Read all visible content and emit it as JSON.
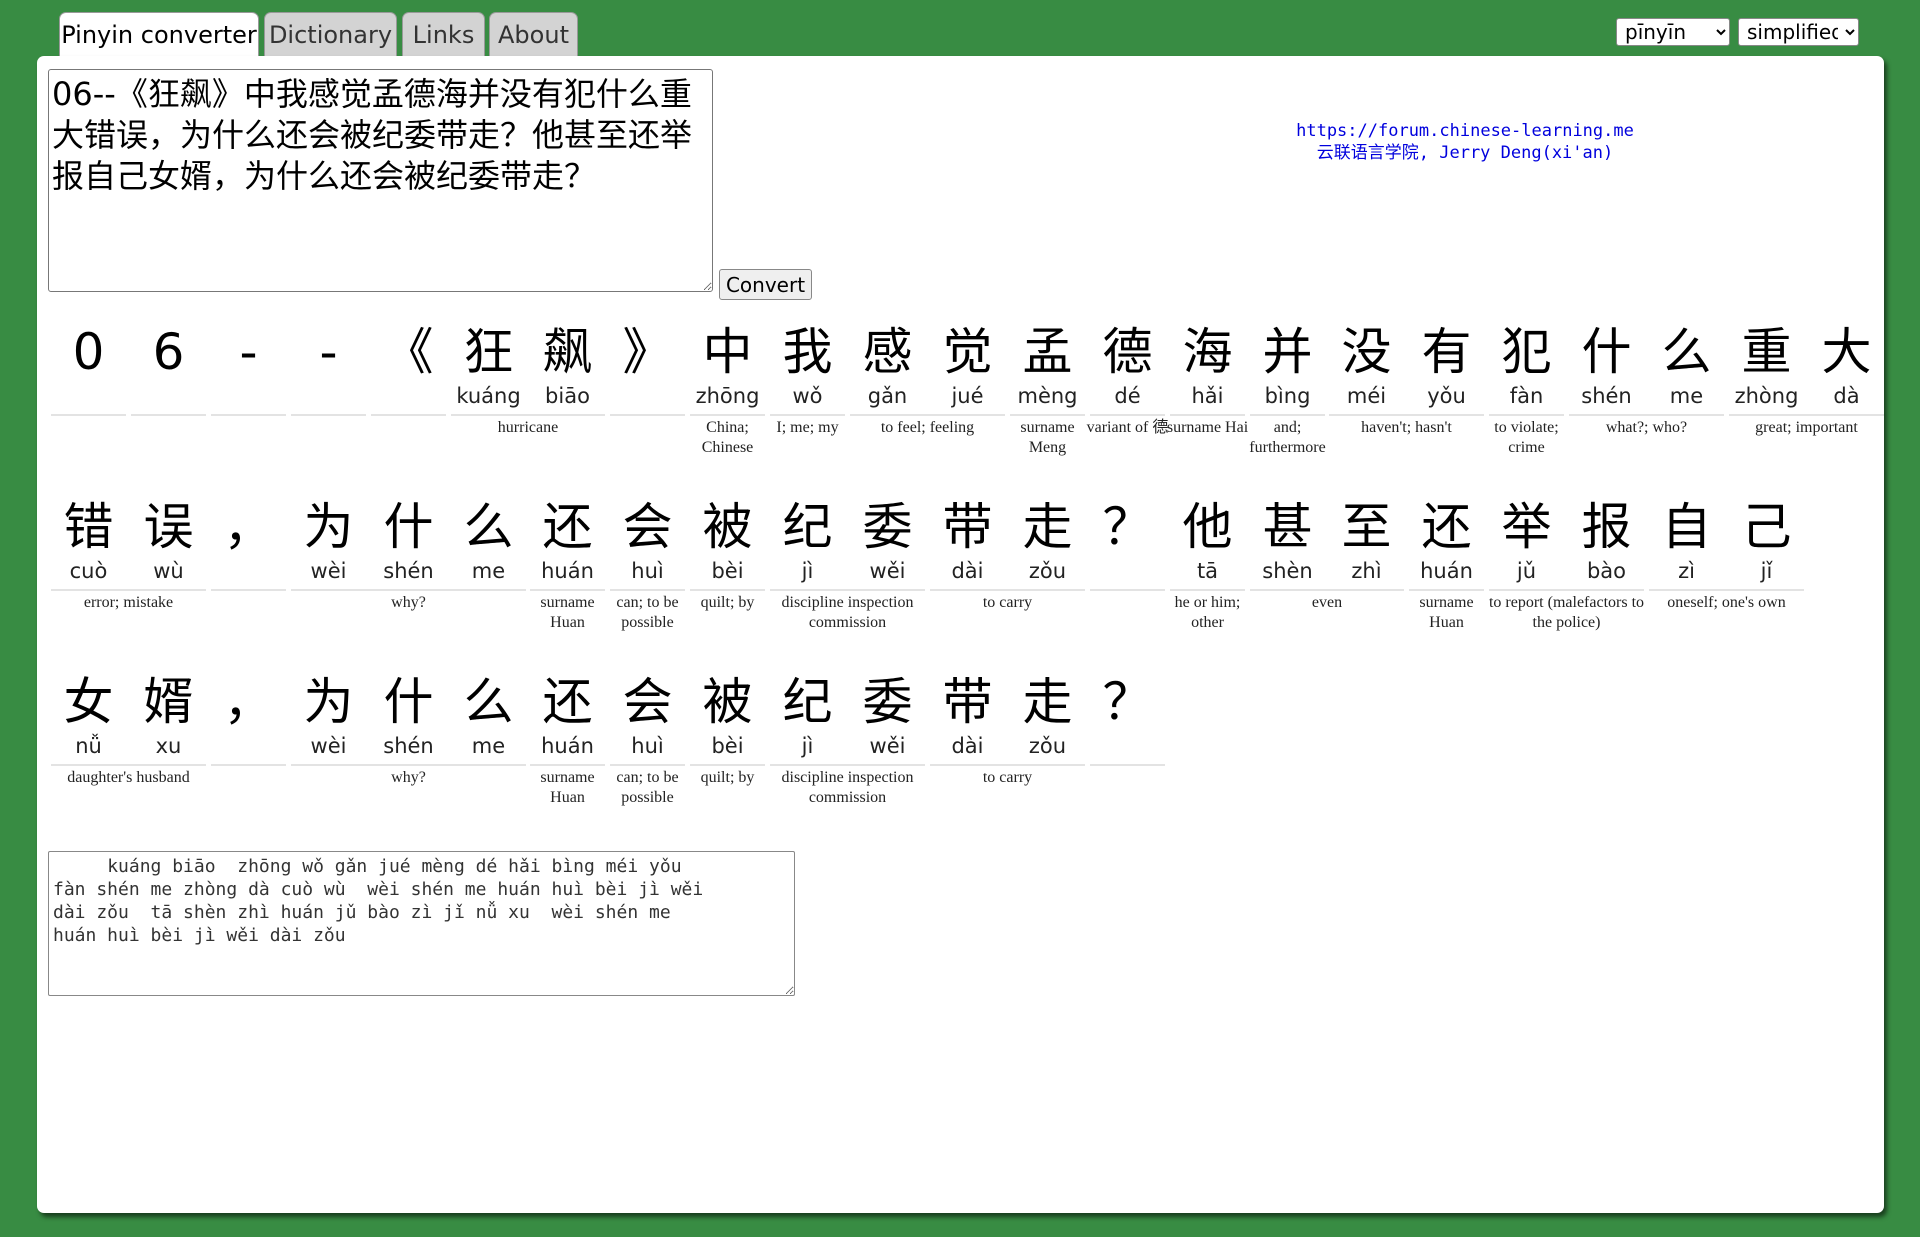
{
  "tabs": [
    {
      "label": "Pinyin converter",
      "active": true
    },
    {
      "label": "Dictionary",
      "active": false
    },
    {
      "label": "Links",
      "active": false
    },
    {
      "label": "About",
      "active": false
    }
  ],
  "selectors": {
    "romanization": {
      "value": "pīnyīn"
    },
    "script": {
      "value": "simplified"
    }
  },
  "input_text": "06--《狂飙》中我感觉孟德海并没有犯什么重大错误，为什么还会被纪委带走？他甚至还举报自己女婿，为什么还会被纪委带走？",
  "convert_label": "Convert",
  "credit": {
    "url": "https://forum.chinese-learning.me",
    "author": "云联语言学院, Jerry Deng(xi'an)"
  },
  "rows": [
    {
      "cells": [
        {
          "hz": "0",
          "py": ""
        },
        {
          "hz": "6",
          "py": ""
        },
        {
          "hz": "-",
          "py": ""
        },
        {
          "hz": "-",
          "py": ""
        },
        {
          "hz": "《",
          "py": ""
        },
        {
          "hz": "狂",
          "py": "kuáng"
        },
        {
          "hz": "飙",
          "py": "biāo"
        },
        {
          "hz": "》",
          "py": ""
        },
        {
          "hz": "中",
          "py": "zhōng"
        },
        {
          "hz": "我",
          "py": "wǒ"
        },
        {
          "hz": "感",
          "py": "gǎn"
        },
        {
          "hz": "觉",
          "py": "jué"
        },
        {
          "hz": "孟",
          "py": "mèng"
        },
        {
          "hz": "德",
          "py": "dé"
        },
        {
          "hz": "海",
          "py": "hǎi"
        },
        {
          "hz": "并",
          "py": "bìng"
        },
        {
          "hz": "没",
          "py": "méi"
        },
        {
          "hz": "有",
          "py": "yǒu"
        },
        {
          "hz": "犯",
          "py": "fàn"
        },
        {
          "hz": "什",
          "py": "shén"
        },
        {
          "hz": "么",
          "py": "me"
        },
        {
          "hz": "重",
          "py": "zhòng"
        },
        {
          "hz": "大",
          "py": "dà"
        }
      ],
      "definitions": [
        {
          "text": "hurricane"
        },
        {
          "text": "China; Chinese"
        },
        {
          "text": "I; me; my"
        },
        {
          "text": "to feel; feeling"
        },
        {
          "text": "surname Meng"
        },
        {
          "text": "variant of 德"
        },
        {
          "text": "surname Hai"
        },
        {
          "text": "and; furthermore"
        },
        {
          "text": "haven't; hasn't"
        },
        {
          "text": "to violate; crime"
        },
        {
          "text": "what?; who?"
        },
        {
          "text": "great; important"
        }
      ]
    },
    {
      "cells": [
        {
          "hz": "错",
          "py": "cuò"
        },
        {
          "hz": "误",
          "py": "wù"
        },
        {
          "hz": "，",
          "py": ""
        },
        {
          "hz": "为",
          "py": "wèi"
        },
        {
          "hz": "什",
          "py": "shén"
        },
        {
          "hz": "么",
          "py": "me"
        },
        {
          "hz": "还",
          "py": "huán"
        },
        {
          "hz": "会",
          "py": "huì"
        },
        {
          "hz": "被",
          "py": "bèi"
        },
        {
          "hz": "纪",
          "py": "jì"
        },
        {
          "hz": "委",
          "py": "wěi"
        },
        {
          "hz": "带",
          "py": "dài"
        },
        {
          "hz": "走",
          "py": "zǒu"
        },
        {
          "hz": "？",
          "py": ""
        },
        {
          "hz": "他",
          "py": "tā"
        },
        {
          "hz": "甚",
          "py": "shèn"
        },
        {
          "hz": "至",
          "py": "zhì"
        },
        {
          "hz": "还",
          "py": "huán"
        },
        {
          "hz": "举",
          "py": "jǔ"
        },
        {
          "hz": "报",
          "py": "bào"
        },
        {
          "hz": "自",
          "py": "zì"
        },
        {
          "hz": "己",
          "py": "jǐ"
        }
      ],
      "definitions": [
        {
          "text": "error; mistake"
        },
        {
          "text": "why?"
        },
        {
          "text": "surname Huan"
        },
        {
          "text": "can; to be possible"
        },
        {
          "text": "quilt; by"
        },
        {
          "text": "discipline inspection commission"
        },
        {
          "text": "to carry"
        },
        {
          "text": "he or him; other"
        },
        {
          "text": "even"
        },
        {
          "text": "surname Huan"
        },
        {
          "text": "to report (malefactors to the police)"
        },
        {
          "text": "oneself; one's own"
        }
      ]
    },
    {
      "cells": [
        {
          "hz": "女",
          "py": "nǚ"
        },
        {
          "hz": "婿",
          "py": "xu"
        },
        {
          "hz": "，",
          "py": ""
        },
        {
          "hz": "为",
          "py": "wèi"
        },
        {
          "hz": "什",
          "py": "shén"
        },
        {
          "hz": "么",
          "py": "me"
        },
        {
          "hz": "还",
          "py": "huán"
        },
        {
          "hz": "会",
          "py": "huì"
        },
        {
          "hz": "被",
          "py": "bèi"
        },
        {
          "hz": "纪",
          "py": "jì"
        },
        {
          "hz": "委",
          "py": "wěi"
        },
        {
          "hz": "带",
          "py": "dài"
        },
        {
          "hz": "走",
          "py": "zǒu"
        },
        {
          "hz": "？",
          "py": ""
        }
      ],
      "definitions": [
        {
          "text": "daughter's husband"
        },
        {
          "text": "why?"
        },
        {
          "text": "surname Huan"
        },
        {
          "text": "can; to be possible"
        },
        {
          "text": "quilt; by"
        },
        {
          "text": "discipline inspection commission"
        },
        {
          "text": "to carry"
        }
      ]
    }
  ],
  "output_text": "     kuáng biāo  zhōng wǒ gǎn jué mèng dé hǎi bìng méi yǒu\nfàn shén me zhòng dà cuò wù  wèi shén me huán huì bèi jì wěi\ndài zǒu  tā shèn zhì huán jǔ bào zì jǐ nǚ xu  wèi shén me\nhuán huì bèi jì wěi dài zǒu"
}
